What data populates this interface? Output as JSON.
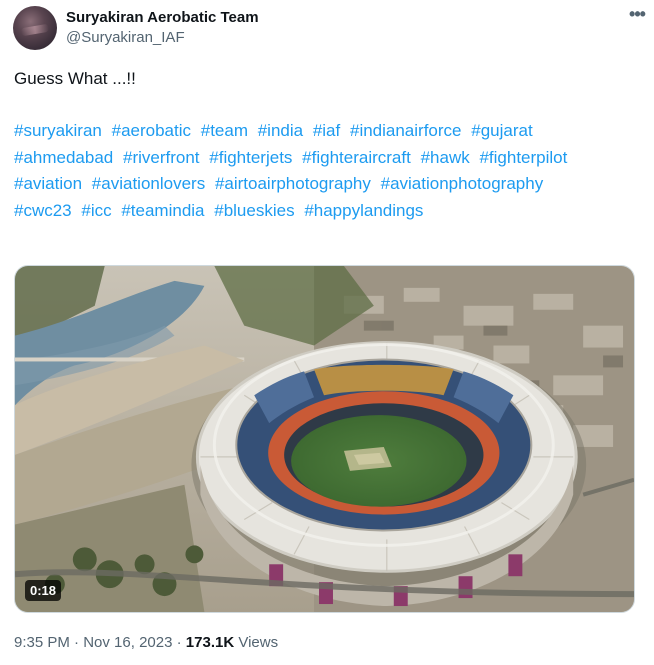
{
  "author": {
    "display_name": "Suryakiran Aerobatic Team",
    "handle": "@Suryakiran_IAF"
  },
  "more_icon": "more-horizontal-icon",
  "text": "Guess What ...!!",
  "hashtags": [
    "#suryakiran",
    "#aerobatic",
    "#team",
    "#india",
    "#iaf",
    "#indianairforce",
    "#gujarat",
    "#ahmedabad",
    "#riverfront",
    "#fighterjets",
    "#fighteraircraft",
    "#hawk",
    "#fighterpilot",
    "#aviation",
    "#aviationlovers",
    "#airtoairphotography",
    "#aviationphotography",
    "#cwc23",
    "#icc",
    "#teamindia",
    "#blueskies",
    "#happylandings"
  ],
  "media": {
    "duration": "0:18"
  },
  "meta": {
    "time": "9:35 PM",
    "separator": "·",
    "date": "Nov 16, 2023",
    "views_count": "173.1K",
    "views_label": "Views"
  }
}
